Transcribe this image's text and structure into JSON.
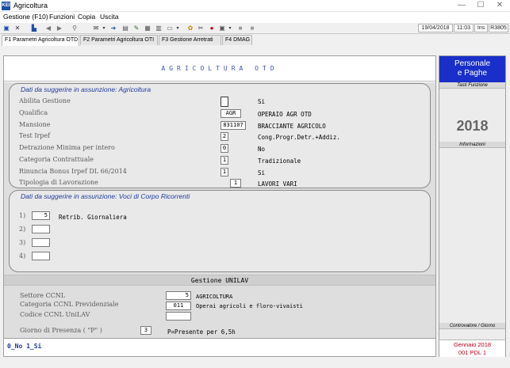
{
  "window": {
    "title": "Agricoltura",
    "icon_text": "KEI",
    "minimize": "—",
    "maximize": "☐",
    "close": "✕"
  },
  "menu": [
    "Gestione (F10)",
    "Funzioni",
    "Copia",
    "Uscita"
  ],
  "toolbar": {
    "date": "19/04/2018",
    "time": "11:03",
    "ins": "Ins",
    "code": "R3805"
  },
  "tabs": [
    "F1 Parametri Agricoltura OTD",
    "F2 Parametri Agricoltura OTI",
    "F3 Gestione Arretrati",
    "F4 DMAG"
  ],
  "banner": "AGRICOLTURA OTD",
  "group1": {
    "title": "Dati da suggerire in assunzione: Agricoltura",
    "rows": [
      {
        "label": "Abilita Gestione",
        "input": "",
        "value": "Si"
      },
      {
        "label": "Qualifica",
        "input": "AGR",
        "value": "OPERAIO AGR OTD"
      },
      {
        "label": "Mansione",
        "input": "831107",
        "value": "BRACCIANTE AGRICOLO"
      },
      {
        "label": "Test Irpef",
        "input": "2",
        "value": "Cong.Progr.Detr.+Addiz."
      },
      {
        "label": "Detrazione Minima per intero",
        "input": "0",
        "value": "No"
      },
      {
        "label": "Categoria Contrattuale",
        "input": "1",
        "value": "Tradizionale"
      },
      {
        "label": "Rinuncia Bonus Irpef DL 66/2014",
        "input": "1",
        "value": "Si"
      },
      {
        "label": "Tipologia di Lavorazione",
        "input": "1",
        "value": "LAVORI VARI"
      }
    ]
  },
  "group2": {
    "title": "Dati da suggerire in assunzione: Voci di Corpo Ricorrenti",
    "rows": [
      {
        "label": "1)",
        "input": "5",
        "value": "Retrib. Giornaliera"
      },
      {
        "label": "2)",
        "input": "",
        "value": ""
      },
      {
        "label": "3)",
        "input": "",
        "value": ""
      },
      {
        "label": "4)",
        "input": "",
        "value": ""
      }
    ]
  },
  "unilav": {
    "title": "Gestione UNILAV",
    "rows": [
      {
        "label": "Settore CCNL",
        "input": "5",
        "value": "AGRICOLTURA"
      },
      {
        "label": "Categoria CCNL Previdenziale",
        "input": "011",
        "value": "Operai agricoli e floro-vivaisti"
      },
      {
        "label": "Codice CCNL UniLAV",
        "input": "",
        "value": ""
      },
      {
        "label": "Giorno di Presenza ( \"P\" )",
        "input": "3",
        "value": "P=Presente per 6,5h"
      }
    ]
  },
  "legend": "0_No 1_Si",
  "right_panel": {
    "header_line1": "Personale",
    "header_line2": "e Paghe",
    "caption_top": "Tasti Funzione",
    "year": "2018",
    "caption_info": "Informazioni",
    "caption_bottom": "Controvalore / Giorno",
    "footer_month": "Gennaio  2018",
    "footer_pdl": "001 PDL 1"
  }
}
